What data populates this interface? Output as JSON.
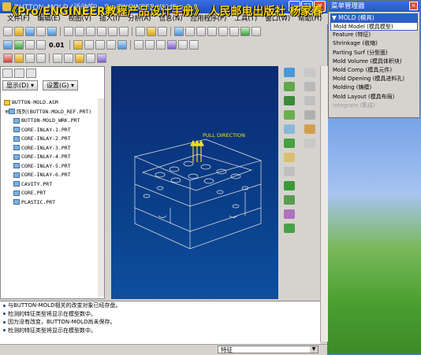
{
  "window": {
    "title": "BUTTON_MOLD (活动的) - Pro/ENGINEER Wildfire 2.0",
    "overlay": "《Pro/ENGINEER教程产品设计手册》 人民邮电出版社 杨家春",
    "buttons": {
      "minimize": "_",
      "maximize": "□",
      "close": "×"
    }
  },
  "menubar": [
    "文件(F)",
    "编辑(E)",
    "视图(V)",
    "插入(I)",
    "分析(A)",
    "信息(N)",
    "应用程序(P)",
    "工具(T)",
    "窗口(W)",
    "帮助(H)"
  ],
  "toolbar": {
    "scale_label": "0.01"
  },
  "left_panel": {
    "display_button": "显示(D) ▾",
    "settings_button": "设置(G) ▾",
    "tree": [
      {
        "label": "BUTTON-MOLD.ASM",
        "type": "asm"
      },
      {
        "label": "阵列(BUTTON-MOLD_REF.PRT)",
        "type": "prt"
      },
      {
        "label": "BUTTON-MOLD_WRK.PRT",
        "type": "prt"
      },
      {
        "label": "CORE-INLAY-1.PRT",
        "type": "prt"
      },
      {
        "label": "CORE-INLAY-2.PRT",
        "type": "prt"
      },
      {
        "label": "CORE-INLAY-3.PRT",
        "type": "prt"
      },
      {
        "label": "CORE-INLAY-4.PRT",
        "type": "prt"
      },
      {
        "label": "CORE-INLAY-5.PRT",
        "type": "prt"
      },
      {
        "label": "CORE-INLAY-6.PRT",
        "type": "prt"
      },
      {
        "label": "CAVITY.PRT",
        "type": "prt"
      },
      {
        "label": "CORE.PRT",
        "type": "prt"
      },
      {
        "label": "PLASTIC.PRT",
        "type": "prt"
      }
    ]
  },
  "viewport": {
    "pull_direction_label": "PULL DIRECTION"
  },
  "messages": [
    "与BUTTON-MOLD相关的改变对象已经存盘。",
    "检测的特征类型将显示在模型数中。",
    "因为没有改变，BUTTON-MOLD尚未保存。",
    "检测的特征类型将显示在模型数中。"
  ],
  "status": {
    "filter_value": "特征"
  },
  "menu_manager": {
    "title": "菜单管理器",
    "header": "▼ MOLD (模具)",
    "items": [
      {
        "label": "Mold Model (模具模型)",
        "state": "selected"
      },
      {
        "label": "Feature (特征)",
        "state": "normal"
      },
      {
        "label": "Shrinkage (收缩)",
        "state": "normal"
      },
      {
        "label": "Parting Surf (分型面)",
        "state": "normal"
      },
      {
        "label": "Mold Volume (模具体积块)",
        "state": "normal"
      },
      {
        "label": "Mold Comp (模具元件)",
        "state": "normal"
      },
      {
        "label": "Mold Opening (模具进料孔)",
        "state": "normal"
      },
      {
        "label": "Molding (铸模)",
        "state": "normal"
      },
      {
        "label": "Mold Layout (模具布局)",
        "state": "normal"
      },
      {
        "label": "Integrate (集成)",
        "state": "disabled"
      }
    ]
  },
  "colors": {
    "titlebar": "#2a58c8",
    "viewport_bg": "#0a3f8a",
    "model_lines": "#e8e8e8",
    "pull_arrow": "#f0e020"
  }
}
